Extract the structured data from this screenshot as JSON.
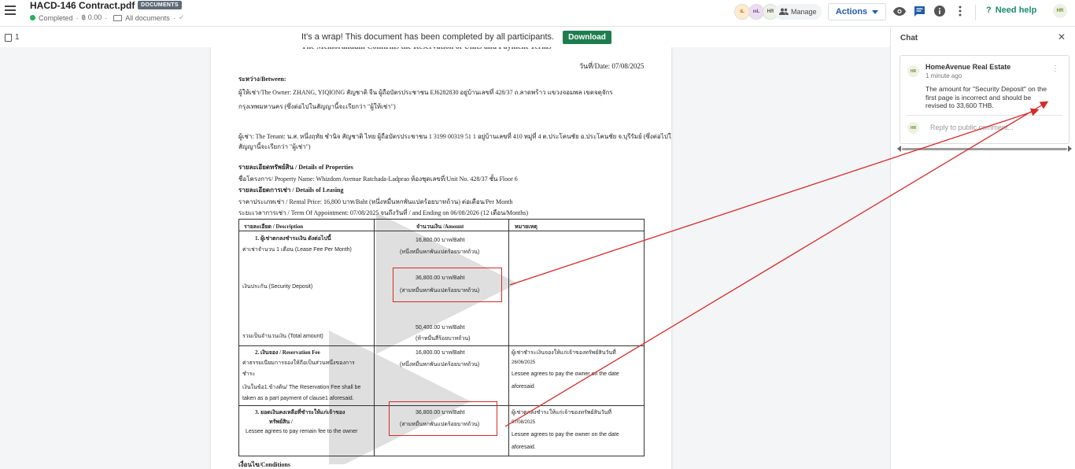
{
  "header": {
    "title": "HACD-146 Contract.pdf",
    "tag": "DOCUMENTS",
    "status": "Completed",
    "amount": "฿ 0.00",
    "folder": "All documents",
    "avatars": [
      "ıL",
      "ıııL",
      "HR"
    ],
    "manage_label": "Manage",
    "actions_label": "Actions",
    "help_label": "Need help",
    "user_initials": "HR"
  },
  "banner": {
    "page_count": "1",
    "message": "It's a wrap! This document has been completed by all participants.",
    "download_label": "Download"
  },
  "document": {
    "date": "วันที่/Date: 07/08/2025",
    "between": "ระหว่าง/Between:",
    "owner_line": "ผู้ให้เช่า/The Owner: ZHANG, YIQIONG  สัญชาติ จีน ผู้ถือบัตรประชาชน EJ6282830  อยู่บ้านเลขที่ 428/37 ถ.ลาดพร้าว แขวงจอมพล เขตจตุจักร",
    "owner_line2": "กรุงเทพมหานคร (ซึ่งต่อไปในสัญญานี้จะเรียกว่า \"ผู้ให้เช่า\")",
    "tenant_line": "ผู้เช่า: The Tenant: น.ส. หนึ่งฤทัย ชำนิจ  สัญชาติ ไทย ผู้ถือบัตรประชาชน 1 3199 00319 51 1  อยู่บ้านเลขที่ 410 หมู่ที่ 4 ต.ประโคนชัย อ.ประโคนชัย จ.บุรีรัมย์ (ซึ่งต่อไปใน",
    "tenant_line2": "สัญญานี้จะเรียกว่า \"ผู้เช่า\")",
    "properties_heading": "รายละเอียดทรัพย์สิน / Details of Properties",
    "project_line": "ชื่อโครงการ/ Property Name: Whizdom Avenue Ratchada-Ladprao ห้องชุดเลขที่/Unit No. 428/37 ชั้น Floor 6",
    "leasing_heading": "รายละเอียดการเช่า / Details of Leasing",
    "price_line": "ราคาประเภทเช่า / Rental Price: 16,800  บาท/Baht (หนึ่งหมื่นหกพันแปดร้อยบาทถ้วน) ต่อเดือน/Per Month",
    "term_line": "ระยะเวลาการเช่า / Term Of Appointment: 07/08/2025  จนถึงวันที่ / and Ending on 06/08/2026 (12 เดือน/Months)",
    "conditions": "เงื่อนไข/Conditions",
    "table": {
      "headers": [
        "รายละเอียด / Description",
        "จำนวนเงิน /Amount",
        "หมายเหตุ"
      ],
      "r1_title": "1.     ผู้เช่าตกลงชำระเงิน ดังต่อไปนี้",
      "r1_a": "ค่าเช่าจำนวน 1 เดือน (Lease Fee Per Month)",
      "r1_a_amt": "16,800.00 บาท/Baht",
      "r1_a_words": "(หนึ่งหมื่นหกพันแปดร้อยบาทถ้วน)",
      "r1_b": "เงินประกัน (Security Deposit)",
      "r1_b_amt": "36,800.00 บาท/Baht",
      "r1_b_words": "(สามหมื่นหกพันแปดร้อยบาทถ้วน)",
      "r1_c": "รวมเป็นจำนวนเงิน (Total amount)",
      "r1_c_amt": "50,400.00 บาท/Baht",
      "r1_c_words": "(ห้าหมื่นสี่ร้อยบาทถ้วน)",
      "r2_title": "2.     เงินจอง / Reservation Fee",
      "r2_l1": "ค่าธรรมเนียมการจองให้ถือเป็นส่วนหนึ่งของการ",
      "r2_l2": "ชำระ",
      "r2_l3": "เงินในข้อ1.ข้างต้น/ The Reservation Fee shall be",
      "r2_l4": "taken as a part payment of clause1 aforesaid.",
      "r2_amt": "16,800.00 บาท/Baht",
      "r2_words": "(หนึ่งหมื่นหกพันแปดร้อยบาทถ้วน)",
      "r2_note1": "ผู้เช่าชำระเงินจองให้แก่เจ้าของทรัพย์สินวันที่",
      "r2_note2": "26/06/2025",
      "r2_note3": "Lessee agrees to pay the owner on the date",
      "r2_note4": "aforesaid",
      "r3_title": "3.     ยอดเงินคงเหลือที่ชำระให้แก่เจ้าของ",
      "r3_title2": "ทรัพย์สิน /",
      "r3_l1": "Lessee agrees to pay remain fee to the owner",
      "r3_amt": "36,800.00 บาท/Baht",
      "r3_words": "(สามหมื่นหกพันแปดร้อยบาทถ้วน)",
      "r3_note1": "ผู้เช่าตกลงชำระให้แก่เจ้าของทรัพย์สินวันที่",
      "r3_note2": "07/08/2025",
      "r3_note3": "Lessee agrees to pay the owner on the date",
      "r3_note4": "aforesaid."
    }
  },
  "chat": {
    "title": "Chat",
    "author_initials": "HR",
    "author": "HomeAvenue Real Estate",
    "time": "1 minute ago",
    "message": "The amount for \"Security Deposit\" on the first page is incorrect and should be revised to 33,600 THB.",
    "reply_placeholder": "Reply to public comment..."
  },
  "colors": {
    "accent_blue": "#1f5da8",
    "download_green": "#1e7d4f",
    "annotation_red": "#d62a2a"
  }
}
